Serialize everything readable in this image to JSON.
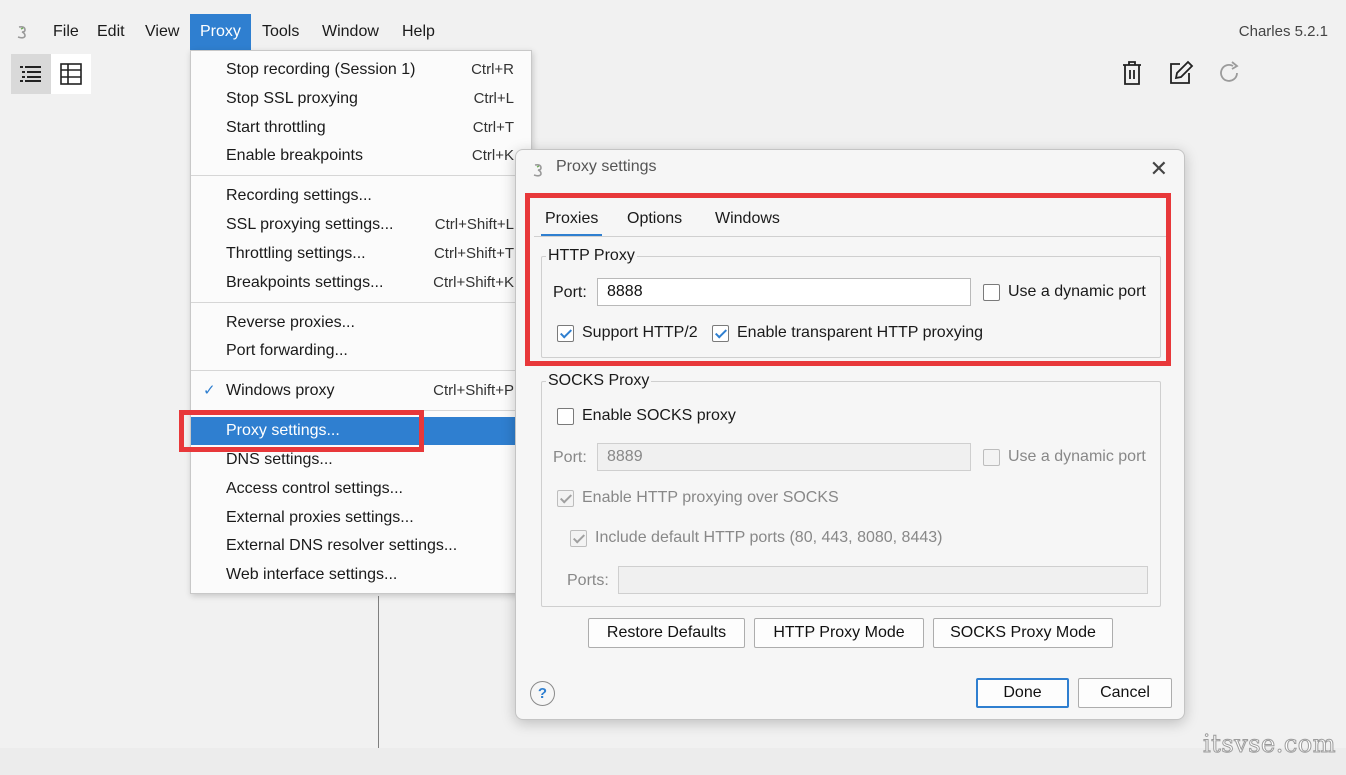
{
  "menubar": {
    "items": [
      "File",
      "Edit",
      "View",
      "Proxy",
      "Tools",
      "Window",
      "Help"
    ],
    "active": "Proxy",
    "version": "Charles 5.2.1"
  },
  "toolbar": {
    "view_icons": [
      "list-view-icon",
      "grid-view-icon"
    ],
    "action_icons": [
      "trash-icon",
      "edit-icon",
      "refresh-icon"
    ]
  },
  "proxy_menu": {
    "groups": [
      [
        {
          "label": "Stop recording (Session 1)",
          "shortcut": "Ctrl+R"
        },
        {
          "label": "Stop SSL proxying",
          "shortcut": "Ctrl+L"
        },
        {
          "label": "Start throttling",
          "shortcut": "Ctrl+T"
        },
        {
          "label": "Enable breakpoints",
          "shortcut": "Ctrl+K"
        }
      ],
      [
        {
          "label": "Recording settings...",
          "shortcut": ""
        },
        {
          "label": "SSL proxying settings...",
          "shortcut": "Ctrl+Shift+L"
        },
        {
          "label": "Throttling settings...",
          "shortcut": "Ctrl+Shift+T"
        },
        {
          "label": "Breakpoints settings...",
          "shortcut": "Ctrl+Shift+K"
        }
      ],
      [
        {
          "label": "Reverse proxies...",
          "shortcut": ""
        },
        {
          "label": "Port forwarding...",
          "shortcut": ""
        }
      ],
      [
        {
          "label": "Windows proxy",
          "shortcut": "Ctrl+Shift+P",
          "checked": true,
          "check_mark": "✓"
        }
      ],
      [
        {
          "label": "Proxy settings...",
          "shortcut": "",
          "highlighted": true
        },
        {
          "label": "DNS settings...",
          "shortcut": ""
        },
        {
          "label": "Access control settings...",
          "shortcut": ""
        },
        {
          "label": "External proxies settings...",
          "shortcut": ""
        },
        {
          "label": "External DNS resolver settings...",
          "shortcut": ""
        },
        {
          "label": "Web interface settings...",
          "shortcut": ""
        }
      ]
    ]
  },
  "dialog": {
    "title": "Proxy settings",
    "close_glyph": "✕",
    "tabs": [
      "Proxies",
      "Options",
      "Windows"
    ],
    "active_tab": "Proxies",
    "http_proxy": {
      "title": "HTTP Proxy",
      "port_label": "Port:",
      "port_value": "8888",
      "dynamic_port": {
        "label": "Use a dynamic port",
        "checked": false
      },
      "support_http2": {
        "label": "Support HTTP/2",
        "checked": true
      },
      "transparent": {
        "label": "Enable transparent HTTP proxying",
        "checked": true
      }
    },
    "socks_proxy": {
      "title": "SOCKS Proxy",
      "enable": {
        "label": "Enable SOCKS proxy",
        "checked": false
      },
      "port_label": "Port:",
      "port_value": "8889",
      "dynamic_port": {
        "label": "Use a dynamic port",
        "checked": false
      },
      "http_over_socks": {
        "label": "Enable HTTP proxying over SOCKS",
        "checked": true
      },
      "default_ports": {
        "label": "Include default HTTP ports (80, 443, 8080, 8443)",
        "checked": true
      },
      "ports_label": "Ports:",
      "ports_value": ""
    },
    "buttons": {
      "restore": "Restore Defaults",
      "http_mode": "HTTP Proxy Mode",
      "socks_mode": "SOCKS Proxy Mode",
      "done": "Done",
      "cancel": "Cancel",
      "help": "?"
    }
  },
  "watermark": "itsvse.com",
  "colors": {
    "accent": "#2f7fd0",
    "annotation_red": "#e8383a"
  }
}
